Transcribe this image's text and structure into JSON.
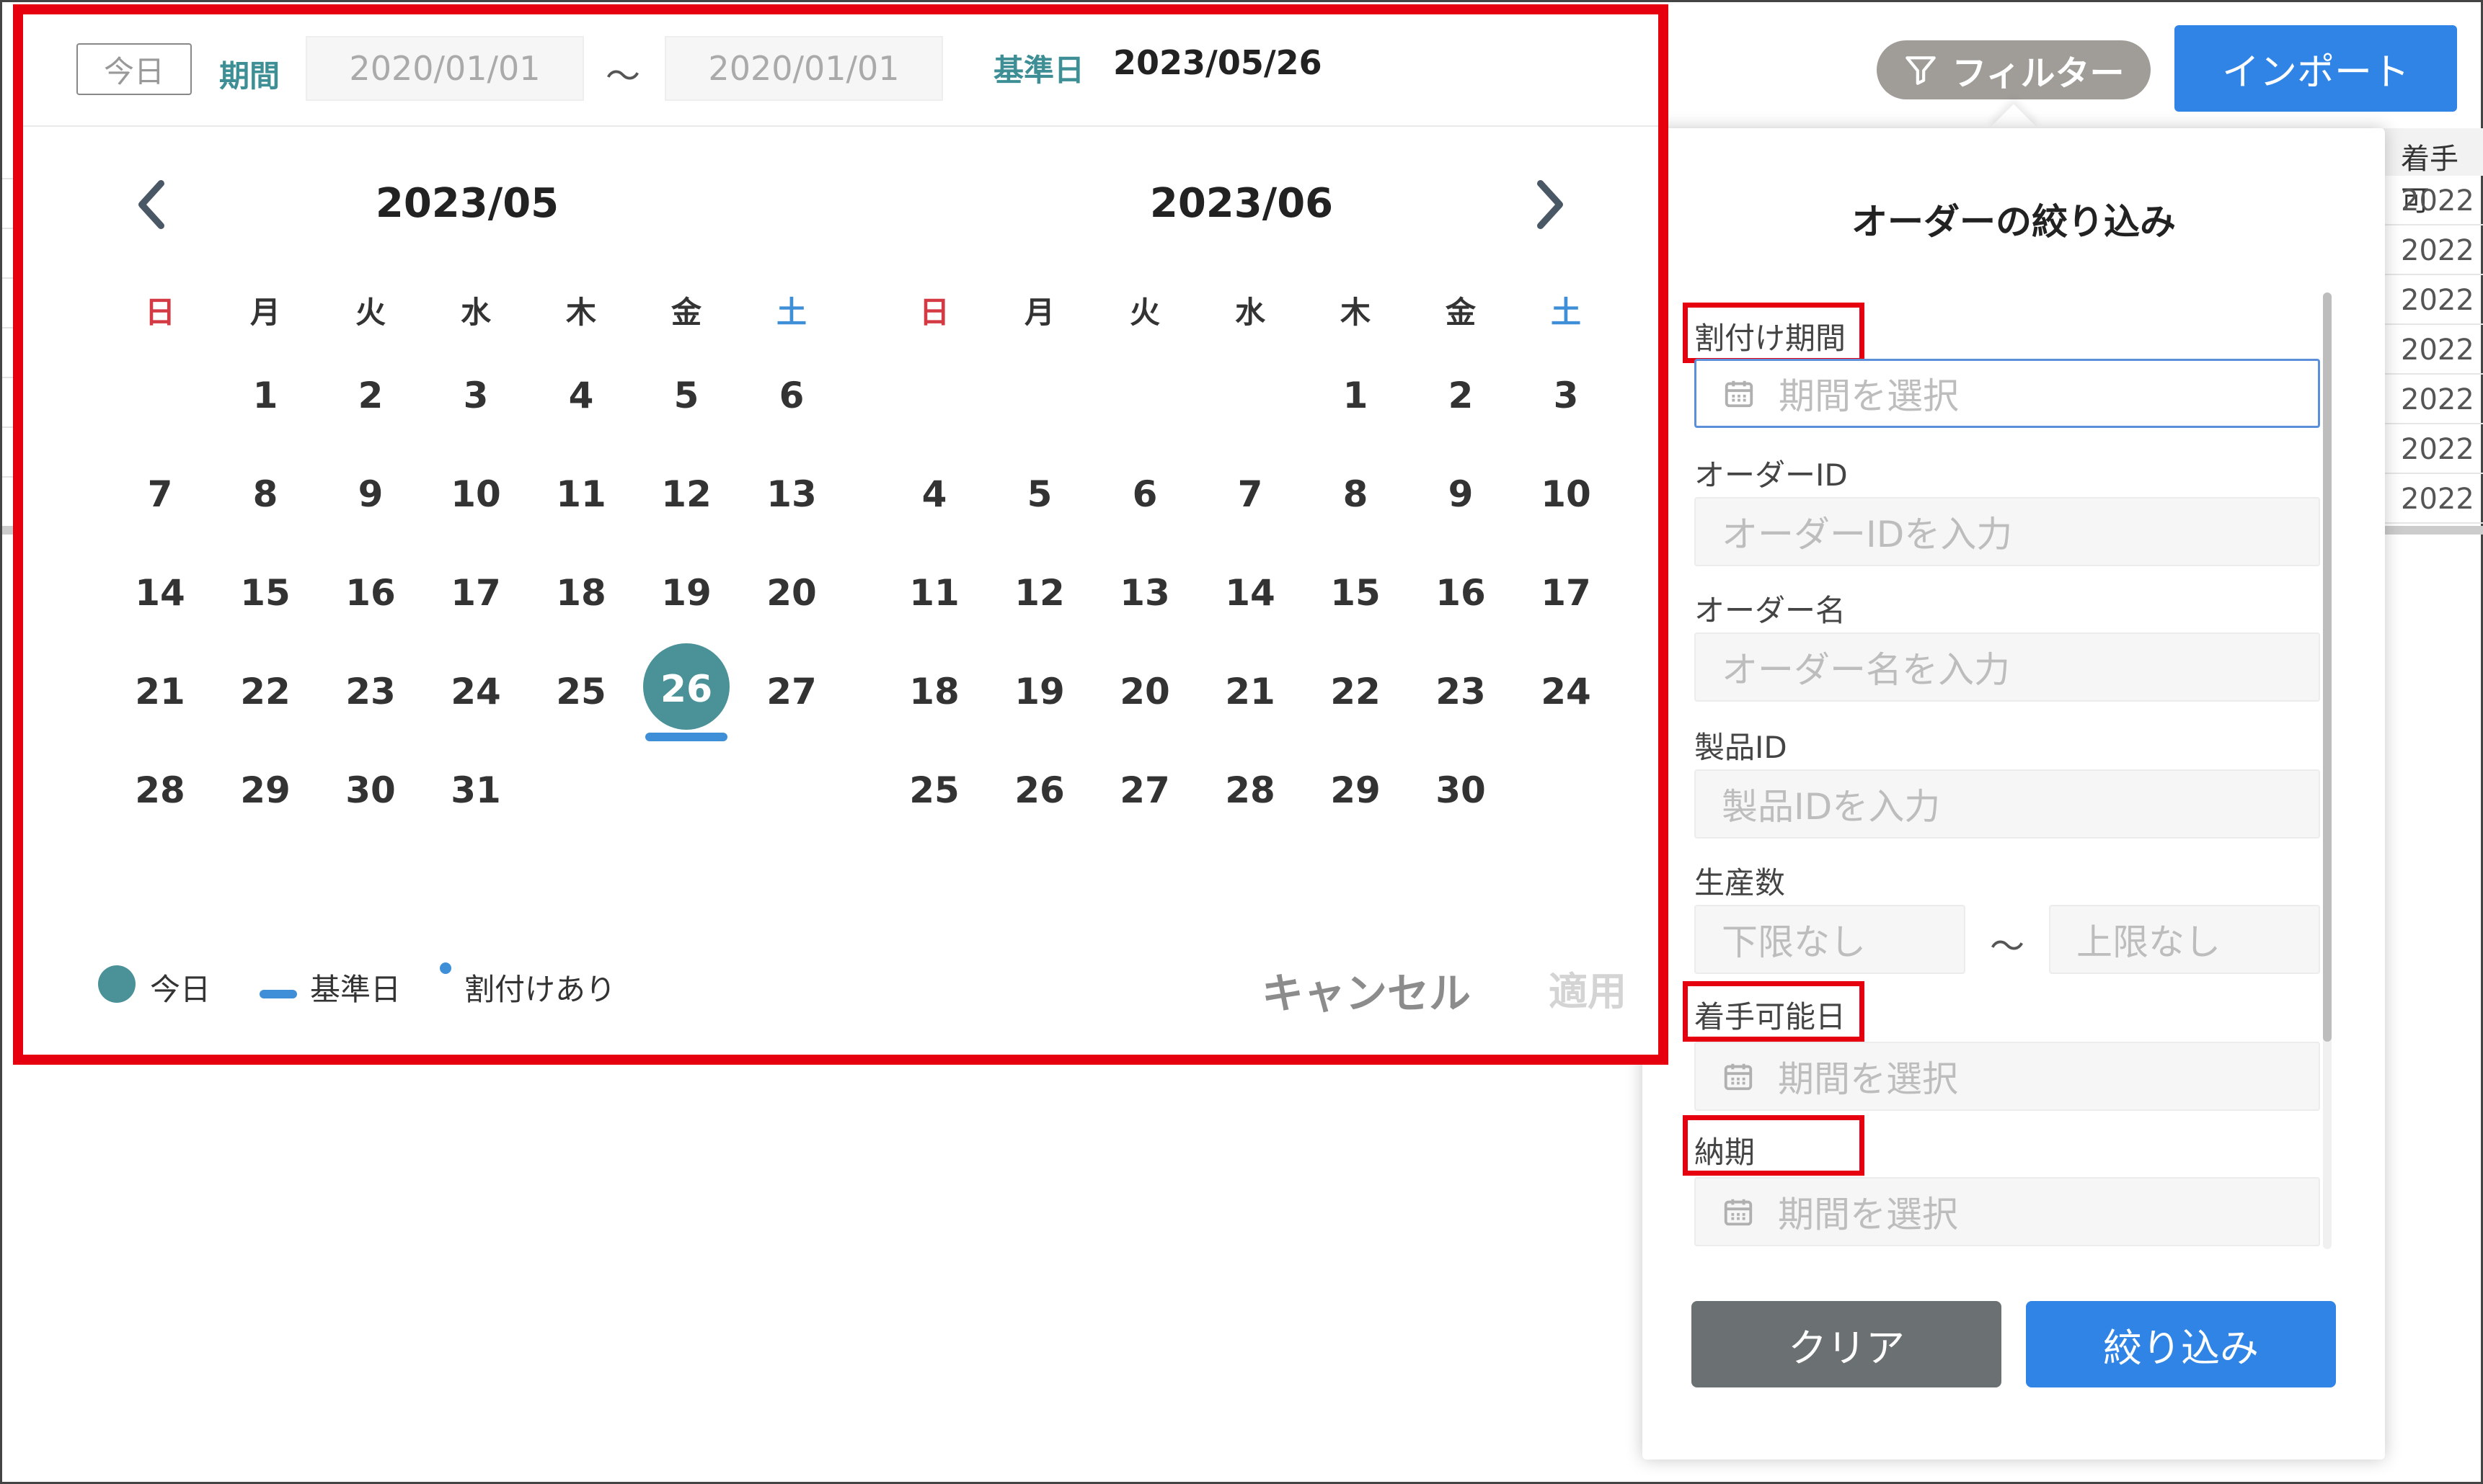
{
  "toolbar": {
    "filter_label": "フィルター",
    "import_label": "インポート"
  },
  "background_table": {
    "header": "着手可",
    "cells": [
      "2022",
      "2022",
      "2022",
      "2022",
      "2022",
      "2022",
      "2022"
    ]
  },
  "filter_panel": {
    "title": "オーダーの絞り込み",
    "fields": {
      "assignment_period": {
        "label": "割付け期間",
        "placeholder": "期間を選択"
      },
      "order_id": {
        "label": "オーダーID",
        "placeholder": "オーダーIDを入力"
      },
      "order_name": {
        "label": "オーダー名",
        "placeholder": "オーダー名を入力"
      },
      "product_id": {
        "label": "製品ID",
        "placeholder": "製品IDを入力"
      },
      "production_qty": {
        "label": "生産数",
        "min_placeholder": "下限なし",
        "max_placeholder": "上限なし",
        "separator": "～"
      },
      "start_date": {
        "label": "着手可能日",
        "placeholder": "期間を選択"
      },
      "due_date": {
        "label": "納期",
        "placeholder": "期間を選択"
      }
    },
    "clear_label": "クリア",
    "apply_label": "絞り込み"
  },
  "calendar": {
    "today_button": "今日",
    "period_label": "期間",
    "period_start": "2020/01/01",
    "period_end": "2020/01/01",
    "range_separator": "～",
    "base_date_label": "基準日",
    "base_date_value": "2023/05/26",
    "weekdays": [
      "日",
      "月",
      "火",
      "水",
      "木",
      "金",
      "土"
    ],
    "months": [
      {
        "title": "2023/05",
        "first_weekday": 1,
        "days": 31,
        "today": 26,
        "base_date": 26
      },
      {
        "title": "2023/06",
        "first_weekday": 4,
        "days": 30
      }
    ],
    "legend": {
      "today": "今日",
      "base_date": "基準日",
      "assigned": "割付けあり"
    },
    "cancel_label": "キャンセル",
    "ok_label": "適用",
    "colors": {
      "today": "#4a9298",
      "base_date": "#3f8fd8",
      "sunday": "#d43a44",
      "saturday": "#3f8fd8",
      "highlight": "#e6000f"
    }
  }
}
